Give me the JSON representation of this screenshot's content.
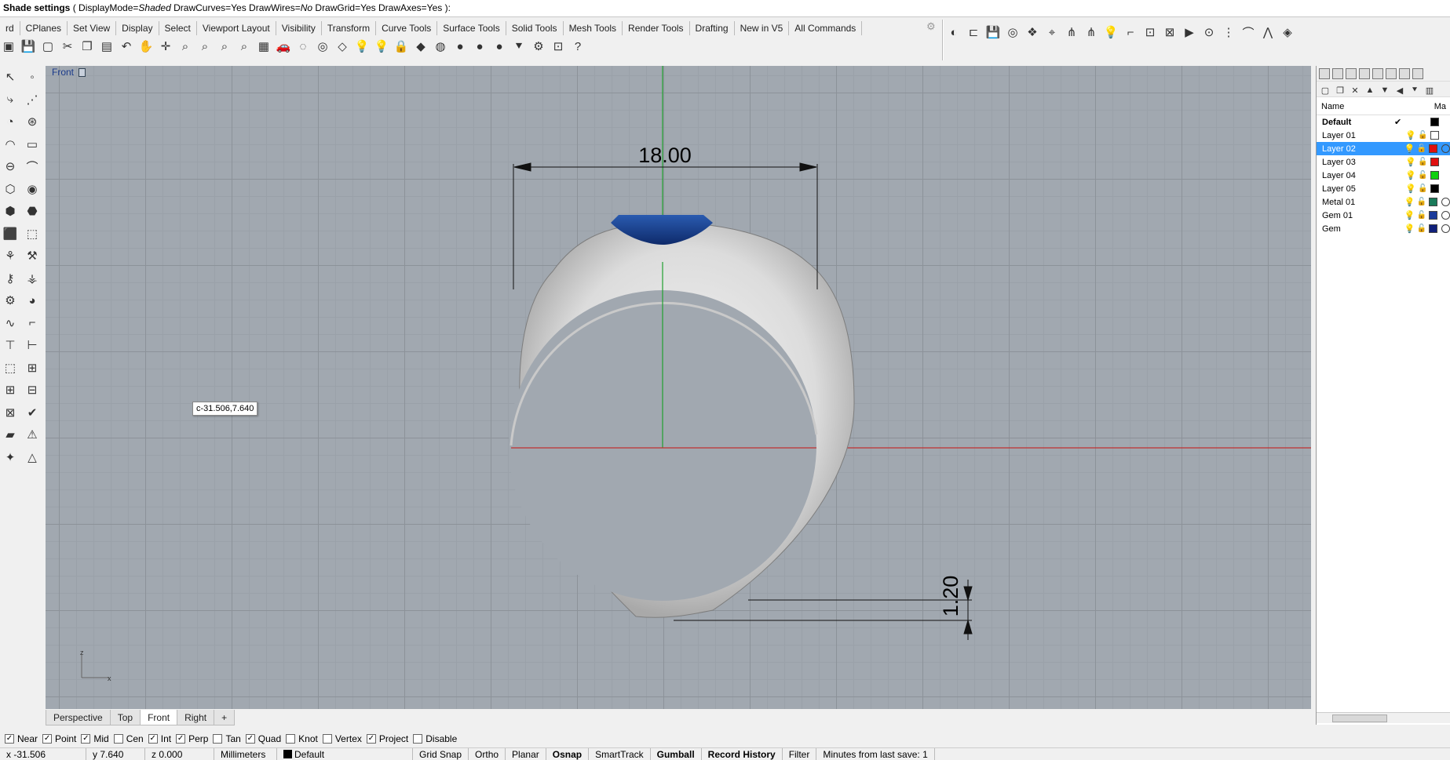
{
  "command": {
    "title": "Shade settings",
    "args": "( DisplayMode=",
    "mode": "Shaded",
    "rest1": " DrawCurves=Yes  DrawWires=",
    "wires": "No",
    "rest2": "  DrawGrid=Yes  DrawAxes=Yes ):"
  },
  "tabs": [
    "rd",
    "CPlanes",
    "Set View",
    "Display",
    "Select",
    "Viewport Layout",
    "Visibility",
    "Transform",
    "Curve Tools",
    "Surface Tools",
    "Solid Tools",
    "Mesh Tools",
    "Render Tools",
    "Drafting",
    "New in V5",
    "All Commands"
  ],
  "viewport": {
    "name": "Front",
    "dimension_width": "18.00",
    "dimension_thickness": "1.20",
    "coord_tooltip": "c-31.506,7.640",
    "axis_z": "z",
    "axis_x": "x"
  },
  "viewport_tabs": [
    "Perspective",
    "Top",
    "Front",
    "Right"
  ],
  "viewport_tabs_active": "Front",
  "layers_panel": {
    "col_name": "Name",
    "col_material": "Ma",
    "layers": [
      {
        "name": "Default",
        "color": "#000000",
        "current": true,
        "material": false
      },
      {
        "name": "Layer 01",
        "color": "#ffffff",
        "material": false
      },
      {
        "name": "Layer 02",
        "color": "#e01010",
        "material": true,
        "selected": true
      },
      {
        "name": "Layer 03",
        "color": "#e01010",
        "material": false
      },
      {
        "name": "Layer 04",
        "color": "#10d010",
        "material": false
      },
      {
        "name": "Layer 05",
        "color": "#000000",
        "material": false
      },
      {
        "name": "Metal 01",
        "color": "#1a7a5a",
        "material": true
      },
      {
        "name": "Gem 01",
        "color": "#1a3a9a",
        "material": true
      },
      {
        "name": "Gem",
        "color": "#10207a",
        "material": true
      }
    ]
  },
  "osnaps": [
    {
      "label": "Near",
      "checked": true
    },
    {
      "label": "Point",
      "checked": true
    },
    {
      "label": "Mid",
      "checked": true
    },
    {
      "label": "Cen",
      "checked": false
    },
    {
      "label": "Int",
      "checked": true
    },
    {
      "label": "Perp",
      "checked": true
    },
    {
      "label": "Tan",
      "checked": false
    },
    {
      "label": "Quad",
      "checked": true
    },
    {
      "label": "Knot",
      "checked": false
    },
    {
      "label": "Vertex",
      "checked": false
    },
    {
      "label": "Project",
      "checked": true
    },
    {
      "label": "Disable",
      "checked": false
    }
  ],
  "status": {
    "x": "x -31.506",
    "y": "y 7.640",
    "z": "z 0.000",
    "units": "Millimeters",
    "layer": "Default",
    "toggles": [
      {
        "label": "Grid Snap",
        "bold": false
      },
      {
        "label": "Ortho",
        "bold": false
      },
      {
        "label": "Planar",
        "bold": false
      },
      {
        "label": "Osnap",
        "bold": true
      },
      {
        "label": "SmartTrack",
        "bold": false
      },
      {
        "label": "Gumball",
        "bold": true
      },
      {
        "label": "Record History",
        "bold": true
      },
      {
        "label": "Filter",
        "bold": false
      }
    ],
    "save": "Minutes from last save: 1"
  }
}
